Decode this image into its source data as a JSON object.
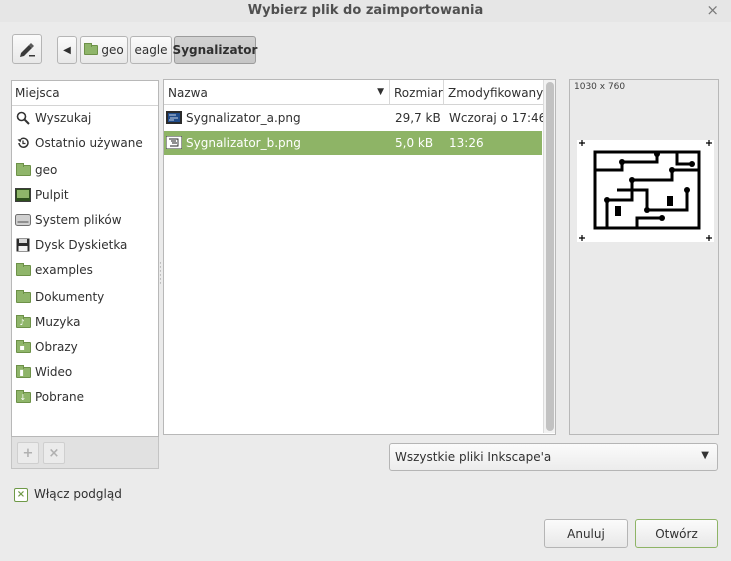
{
  "dialog": {
    "title": "Wybierz plik do zaimportowania",
    "close_glyph": "×"
  },
  "toolbar": {
    "edit_icon": "pencil-icon",
    "back_glyph": "◀",
    "breadcrumbs": [
      "geo",
      "eagle",
      "Sygnalizator"
    ]
  },
  "places": {
    "header": "Miejsca",
    "items": [
      {
        "label": "Wyszukaj",
        "icon": "search-icon"
      },
      {
        "label": "Ostatnio używane",
        "icon": "recent-icon"
      },
      {
        "label": "geo",
        "icon": "home-folder-icon"
      },
      {
        "label": "Pulpit",
        "icon": "desktop-icon"
      },
      {
        "label": "System plików",
        "icon": "drive-icon"
      },
      {
        "label": "Dysk Dyskietka",
        "icon": "floppy-icon"
      },
      {
        "label": "examples",
        "icon": "folder-icon"
      },
      {
        "label": "Dokumenty",
        "icon": "documents-folder-icon"
      },
      {
        "label": "Muzyka",
        "icon": "music-folder-icon"
      },
      {
        "label": "Obrazy",
        "icon": "pictures-folder-icon"
      },
      {
        "label": "Wideo",
        "icon": "video-folder-icon"
      },
      {
        "label": "Pobrane",
        "icon": "downloads-folder-icon"
      }
    ],
    "add_glyph": "+",
    "remove_glyph": "×"
  },
  "files": {
    "columns": {
      "name": "Nazwa",
      "size": "Rozmiar",
      "modified": "Zmodyfikowany"
    },
    "sort_glyph": "▼",
    "rows": [
      {
        "name": "Sygnalizator_a.png",
        "size": "29,7 kB",
        "modified": "Wczoraj o 17:46",
        "selected": false
      },
      {
        "name": "Sygnalizator_b.png",
        "size": "5,0 kB",
        "modified": "13:26",
        "selected": true
      }
    ]
  },
  "preview": {
    "dimensions": "1030 x 760"
  },
  "filter": {
    "selected": "Wszystkie pliki Inkscape'a",
    "arrow": "▼"
  },
  "options": {
    "preview_label": "Włącz podgląd",
    "preview_checked": true,
    "check_glyph": "×"
  },
  "buttons": {
    "cancel": "Anuluj",
    "open": "Otwórz"
  },
  "colors": {
    "accent": "#8eb466",
    "selected_row": "#8eb466"
  }
}
